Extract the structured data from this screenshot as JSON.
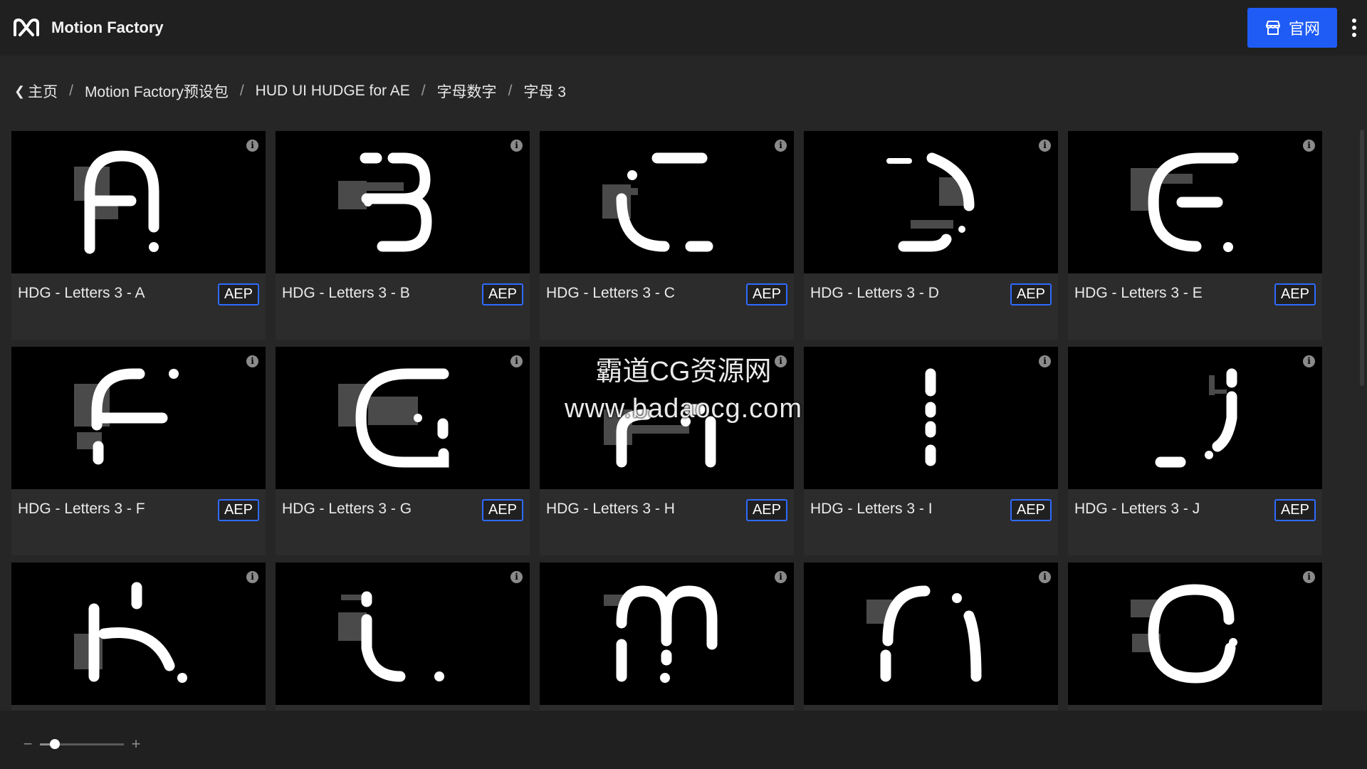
{
  "header": {
    "app_title": "Motion Factory",
    "site_button_label": "官网",
    "logo_icon": "mf-logo-icon",
    "store_icon": "store-icon",
    "menu_icon": "more-vertical-icon",
    "accent_color": "#1f5cf5"
  },
  "breadcrumb": [
    {
      "label": "主页",
      "icon": "chevron-left-icon"
    },
    {
      "label": "Motion Factory预设包"
    },
    {
      "label": "HUD UI HUDGE for AE"
    },
    {
      "label": "字母数字"
    },
    {
      "label": "字母 3"
    }
  ],
  "breadcrumb_separator": "/",
  "items": [
    {
      "title": "HDG - Letters 3 - A",
      "badge": "AEP"
    },
    {
      "title": "HDG - Letters 3 - B",
      "badge": "AEP"
    },
    {
      "title": "HDG - Letters 3 - C",
      "badge": "AEP"
    },
    {
      "title": "HDG - Letters 3 - D",
      "badge": "AEP"
    },
    {
      "title": "HDG - Letters 3 - E",
      "badge": "AEP"
    },
    {
      "title": "HDG - Letters 3 - F",
      "badge": "AEP"
    },
    {
      "title": "HDG - Letters 3 - G",
      "badge": "AEP"
    },
    {
      "title": "HDG - Letters 3 - H",
      "badge": "AEP"
    },
    {
      "title": "HDG - Letters 3 - I",
      "badge": "AEP"
    },
    {
      "title": "HDG - Letters 3 - J",
      "badge": "AEP"
    },
    {
      "title": "",
      "badge": ""
    },
    {
      "title": "",
      "badge": ""
    },
    {
      "title": "",
      "badge": ""
    },
    {
      "title": "",
      "badge": ""
    },
    {
      "title": "",
      "badge": ""
    }
  ],
  "info_icon_glyph": "i",
  "watermark": {
    "line1": "霸道CG资源网",
    "line2": "www.badaocg.com"
  },
  "zoom": {
    "minus": "−",
    "plus": "+",
    "value": 0.18
  }
}
